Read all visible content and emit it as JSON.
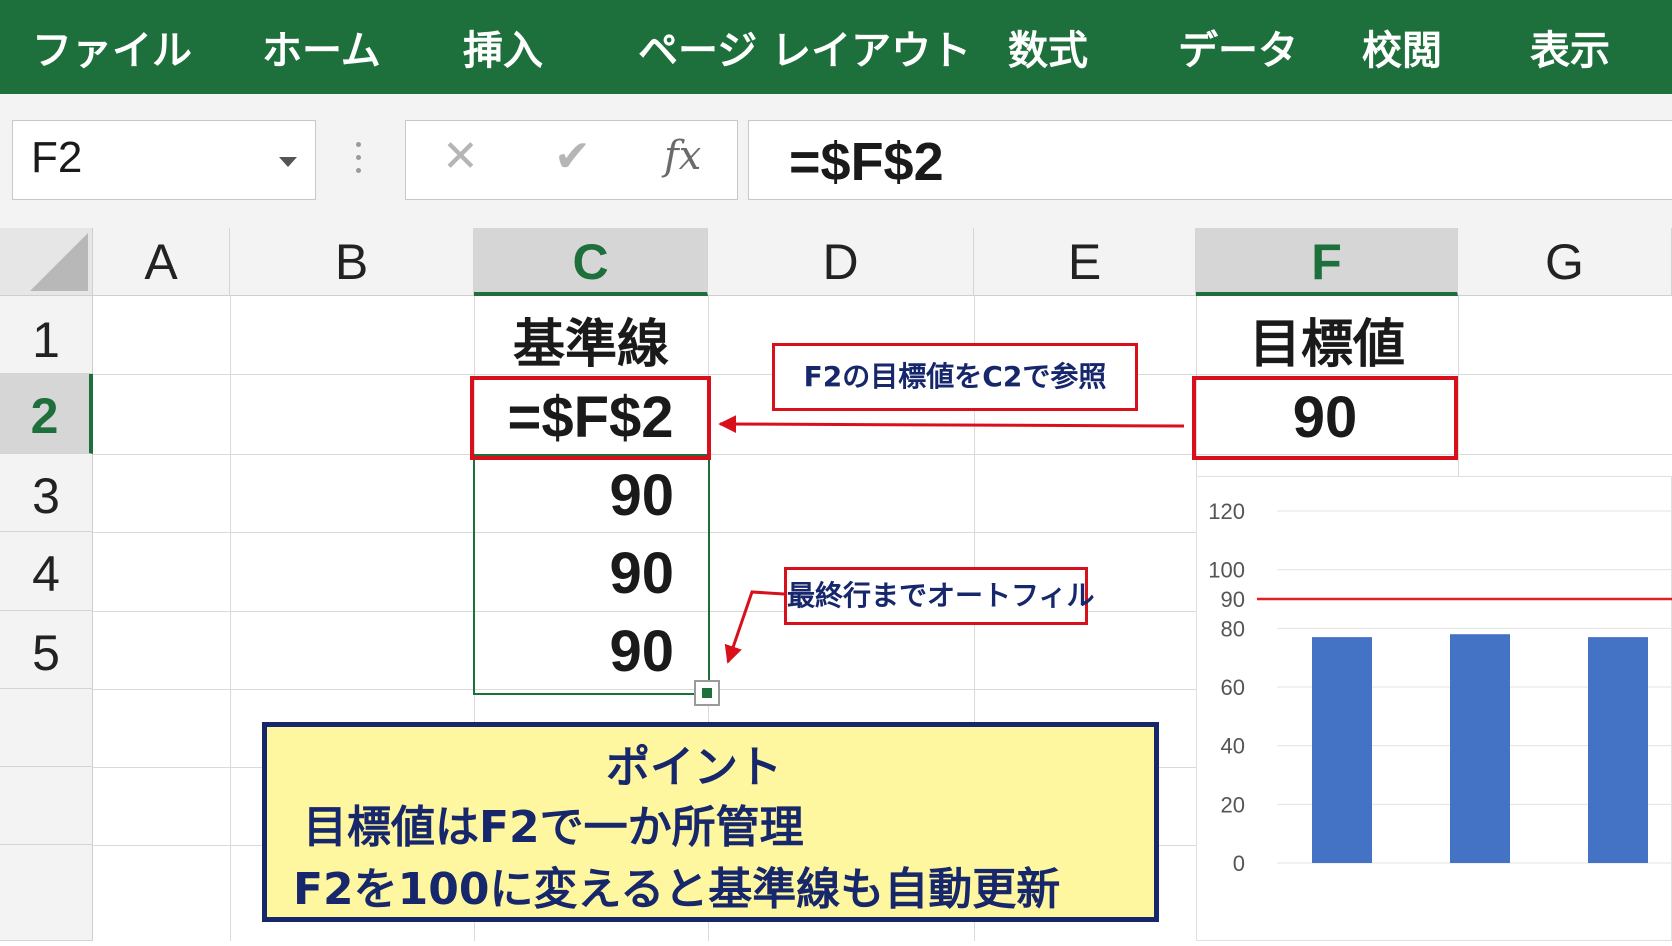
{
  "ribbon": {
    "tabs": [
      "ファイル",
      "ホーム",
      "挿入",
      "ページ レイアウト",
      "数式",
      "データ",
      "校閲",
      "表示"
    ]
  },
  "formula_bar": {
    "name_box": "F2",
    "cancel_symbol": "✕",
    "enter_symbol": "✔",
    "fx_label": "fx",
    "formula": "=$F$2"
  },
  "grid": {
    "columns": [
      "A",
      "B",
      "C",
      "D",
      "E",
      "F",
      "G"
    ],
    "selected_columns": [
      "C",
      "F"
    ],
    "rows": [
      "1",
      "2",
      "3",
      "4",
      "5"
    ],
    "selected_row": "2",
    "cells": {
      "C1": "基準線",
      "C2": "=$F$2",
      "C3": "90",
      "C4": "90",
      "C5": "90",
      "F1": "目標値",
      "F2": "90"
    }
  },
  "annotations": {
    "callout_reference": "F2の目標値をC2で参照",
    "callout_autofill": "最終行までオートフィル",
    "point_title": "ポイント",
    "point_line1": "目標値はF2で一か所管理",
    "point_line2": "F2を100に変えると基準線も自動更新"
  },
  "colors": {
    "ribbon": "#1d6f3b",
    "highlight_red": "#d8101c",
    "callout_text": "#17276b",
    "point_bg": "#fff7a0",
    "bar": "#4472c4",
    "baseline": "#e02020"
  },
  "chart_data": {
    "type": "bar",
    "categories": [
      "",
      "",
      ""
    ],
    "values": [
      77,
      78,
      77
    ],
    "ylim": [
      0,
      120
    ],
    "yticks": [
      0,
      20,
      40,
      60,
      80,
      90,
      100,
      120
    ],
    "baseline": 90,
    "grid": true,
    "legend": "none"
  }
}
